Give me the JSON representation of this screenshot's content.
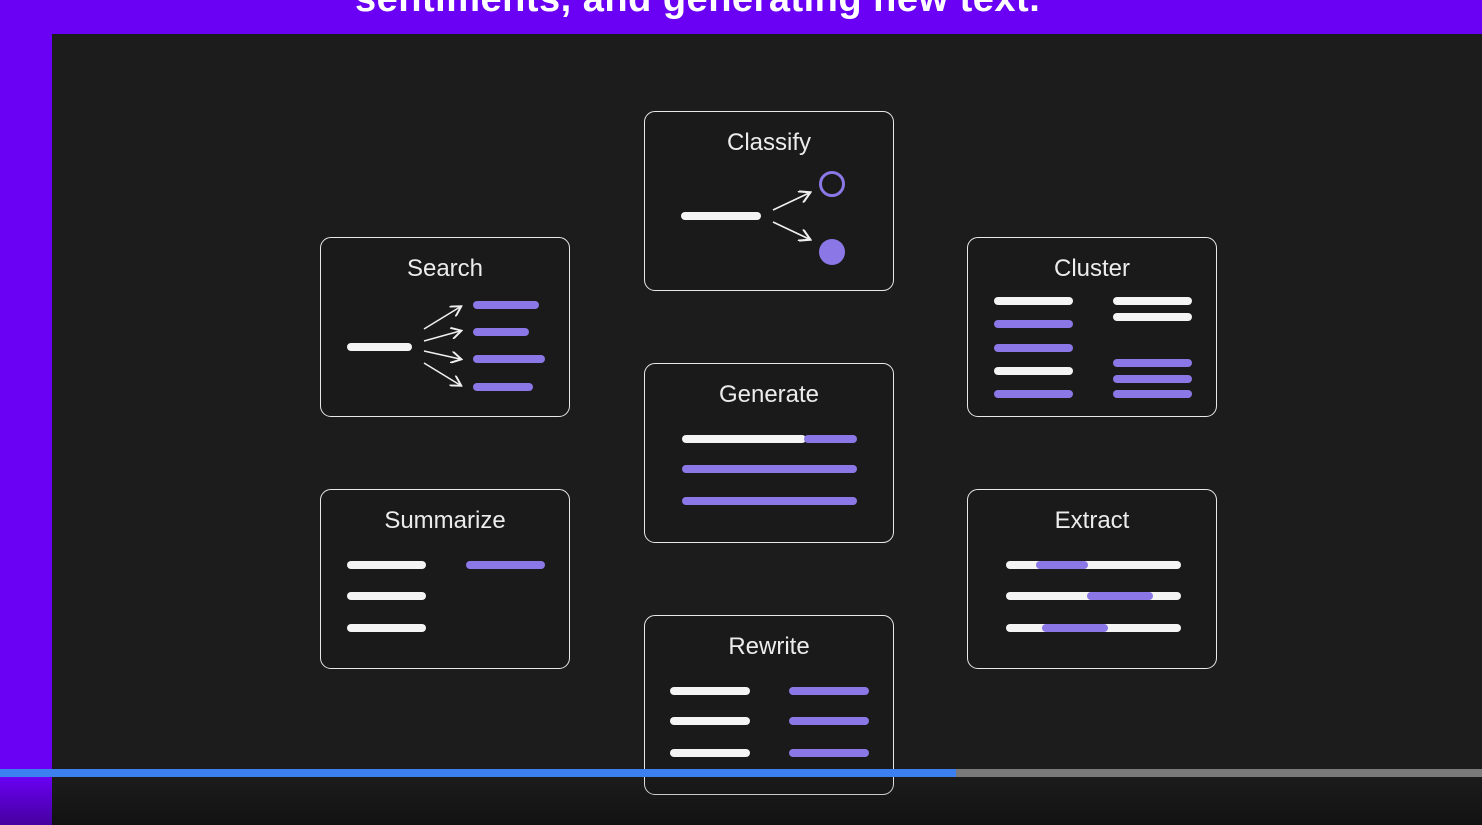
{
  "banner": {
    "caption": "sentiments, and generating new text."
  },
  "cards": {
    "classify": {
      "title": "Classify"
    },
    "search": {
      "title": "Search"
    },
    "cluster": {
      "title": "Cluster"
    },
    "generate": {
      "title": "Generate"
    },
    "summarize": {
      "title": "Summarize"
    },
    "extract": {
      "title": "Extract"
    },
    "rewrite": {
      "title": "Rewrite"
    }
  },
  "colors": {
    "accent_purple": "#8b78e6",
    "banner_purple": "#6a00f4",
    "slide_background": "#1c1c1c",
    "progress_blue": "#3b7ff0"
  },
  "player": {
    "progress": 0.645
  }
}
